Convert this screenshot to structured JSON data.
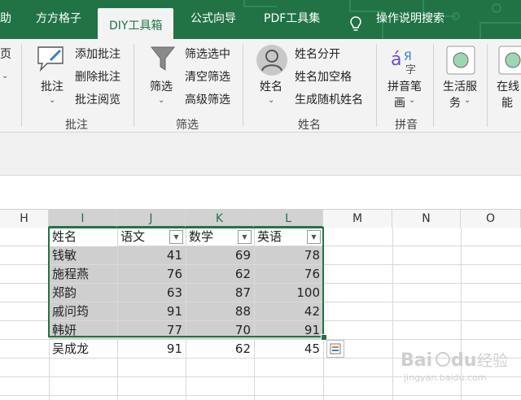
{
  "tabs": [
    {
      "label": "助",
      "active": false
    },
    {
      "label": "方方格子",
      "active": false
    },
    {
      "label": "DIY工具箱",
      "active": true
    },
    {
      "label": "公式向导",
      "active": false
    },
    {
      "label": "PDF工具集",
      "active": false
    },
    {
      "label": "操作说明搜索",
      "active": false
    }
  ],
  "ribbon": {
    "page_fragment": "页",
    "comment": {
      "big_label": "批注",
      "items": [
        "添加批注",
        "删除批注",
        "批注阅览"
      ],
      "group": "批注"
    },
    "filter": {
      "big_label": "筛选",
      "items": [
        "筛选选中",
        "清空筛选",
        "高级筛选"
      ],
      "group": "筛选"
    },
    "name": {
      "big_label": "姓名",
      "items": [
        "姓名分开",
        "姓名加空格",
        "生成随机姓名"
      ],
      "group": "姓名"
    },
    "pinyin": {
      "big_label_1": "拼音笔",
      "big_label_2": "画",
      "group": "拼音"
    },
    "life": {
      "label_1": "生活服",
      "label_2": "务"
    },
    "online": {
      "label_1": "在线",
      "label_2": "能"
    }
  },
  "columns": [
    "H",
    "I",
    "J",
    "K",
    "L",
    "M",
    "N",
    "O"
  ],
  "table": {
    "headers": [
      "姓名",
      "语文",
      "数学",
      "英语"
    ],
    "rows": [
      [
        "钱敏",
        "41",
        "69",
        "78"
      ],
      [
        "施程燕",
        "76",
        "62",
        "76"
      ],
      [
        "郑韵",
        "63",
        "87",
        "100"
      ],
      [
        "戚问筠",
        "91",
        "88",
        "42"
      ],
      [
        "韩妍",
        "77",
        "70",
        "91"
      ],
      [
        "吴成龙",
        "91",
        "62",
        "45"
      ]
    ]
  },
  "watermark": {
    "brand": "Baidu 经验",
    "url": "jingyan.baidu.com"
  },
  "colors": {
    "excel_green": "#217346",
    "ribbon_bg": "#f3f3f3",
    "selection_fill": "#cfcfcf"
  }
}
